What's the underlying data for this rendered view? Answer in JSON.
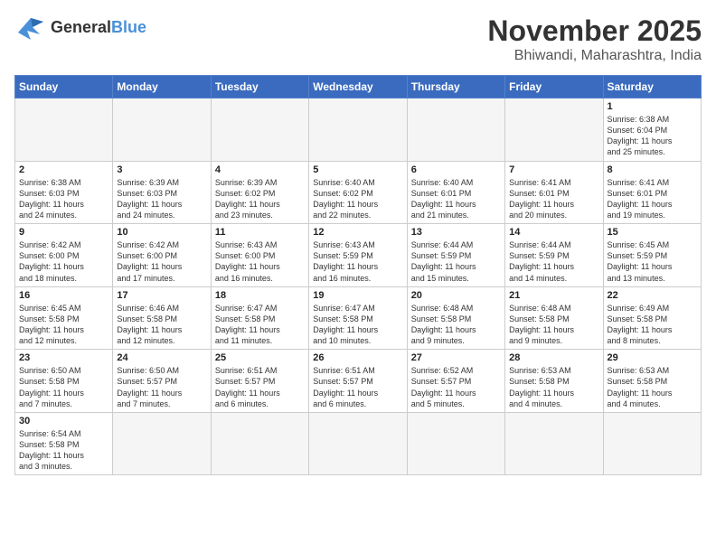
{
  "header": {
    "logo_general": "General",
    "logo_blue": "Blue",
    "month_title": "November 2025",
    "location": "Bhiwandi, Maharashtra, India"
  },
  "days_of_week": [
    "Sunday",
    "Monday",
    "Tuesday",
    "Wednesday",
    "Thursday",
    "Friday",
    "Saturday"
  ],
  "weeks": [
    [
      {
        "day": "",
        "text": ""
      },
      {
        "day": "",
        "text": ""
      },
      {
        "day": "",
        "text": ""
      },
      {
        "day": "",
        "text": ""
      },
      {
        "day": "",
        "text": ""
      },
      {
        "day": "",
        "text": ""
      },
      {
        "day": "1",
        "text": "Sunrise: 6:38 AM\nSunset: 6:04 PM\nDaylight: 11 hours\nand 25 minutes."
      }
    ],
    [
      {
        "day": "2",
        "text": "Sunrise: 6:38 AM\nSunset: 6:03 PM\nDaylight: 11 hours\nand 24 minutes."
      },
      {
        "day": "3",
        "text": "Sunrise: 6:39 AM\nSunset: 6:03 PM\nDaylight: 11 hours\nand 24 minutes."
      },
      {
        "day": "4",
        "text": "Sunrise: 6:39 AM\nSunset: 6:02 PM\nDaylight: 11 hours\nand 23 minutes."
      },
      {
        "day": "5",
        "text": "Sunrise: 6:40 AM\nSunset: 6:02 PM\nDaylight: 11 hours\nand 22 minutes."
      },
      {
        "day": "6",
        "text": "Sunrise: 6:40 AM\nSunset: 6:01 PM\nDaylight: 11 hours\nand 21 minutes."
      },
      {
        "day": "7",
        "text": "Sunrise: 6:41 AM\nSunset: 6:01 PM\nDaylight: 11 hours\nand 20 minutes."
      },
      {
        "day": "8",
        "text": "Sunrise: 6:41 AM\nSunset: 6:01 PM\nDaylight: 11 hours\nand 19 minutes."
      }
    ],
    [
      {
        "day": "9",
        "text": "Sunrise: 6:42 AM\nSunset: 6:00 PM\nDaylight: 11 hours\nand 18 minutes."
      },
      {
        "day": "10",
        "text": "Sunrise: 6:42 AM\nSunset: 6:00 PM\nDaylight: 11 hours\nand 17 minutes."
      },
      {
        "day": "11",
        "text": "Sunrise: 6:43 AM\nSunset: 6:00 PM\nDaylight: 11 hours\nand 16 minutes."
      },
      {
        "day": "12",
        "text": "Sunrise: 6:43 AM\nSunset: 5:59 PM\nDaylight: 11 hours\nand 16 minutes."
      },
      {
        "day": "13",
        "text": "Sunrise: 6:44 AM\nSunset: 5:59 PM\nDaylight: 11 hours\nand 15 minutes."
      },
      {
        "day": "14",
        "text": "Sunrise: 6:44 AM\nSunset: 5:59 PM\nDaylight: 11 hours\nand 14 minutes."
      },
      {
        "day": "15",
        "text": "Sunrise: 6:45 AM\nSunset: 5:59 PM\nDaylight: 11 hours\nand 13 minutes."
      }
    ],
    [
      {
        "day": "16",
        "text": "Sunrise: 6:45 AM\nSunset: 5:58 PM\nDaylight: 11 hours\nand 12 minutes."
      },
      {
        "day": "17",
        "text": "Sunrise: 6:46 AM\nSunset: 5:58 PM\nDaylight: 11 hours\nand 12 minutes."
      },
      {
        "day": "18",
        "text": "Sunrise: 6:47 AM\nSunset: 5:58 PM\nDaylight: 11 hours\nand 11 minutes."
      },
      {
        "day": "19",
        "text": "Sunrise: 6:47 AM\nSunset: 5:58 PM\nDaylight: 11 hours\nand 10 minutes."
      },
      {
        "day": "20",
        "text": "Sunrise: 6:48 AM\nSunset: 5:58 PM\nDaylight: 11 hours\nand 9 minutes."
      },
      {
        "day": "21",
        "text": "Sunrise: 6:48 AM\nSunset: 5:58 PM\nDaylight: 11 hours\nand 9 minutes."
      },
      {
        "day": "22",
        "text": "Sunrise: 6:49 AM\nSunset: 5:58 PM\nDaylight: 11 hours\nand 8 minutes."
      }
    ],
    [
      {
        "day": "23",
        "text": "Sunrise: 6:50 AM\nSunset: 5:58 PM\nDaylight: 11 hours\nand 7 minutes."
      },
      {
        "day": "24",
        "text": "Sunrise: 6:50 AM\nSunset: 5:57 PM\nDaylight: 11 hours\nand 7 minutes."
      },
      {
        "day": "25",
        "text": "Sunrise: 6:51 AM\nSunset: 5:57 PM\nDaylight: 11 hours\nand 6 minutes."
      },
      {
        "day": "26",
        "text": "Sunrise: 6:51 AM\nSunset: 5:57 PM\nDaylight: 11 hours\nand 6 minutes."
      },
      {
        "day": "27",
        "text": "Sunrise: 6:52 AM\nSunset: 5:57 PM\nDaylight: 11 hours\nand 5 minutes."
      },
      {
        "day": "28",
        "text": "Sunrise: 6:53 AM\nSunset: 5:58 PM\nDaylight: 11 hours\nand 4 minutes."
      },
      {
        "day": "29",
        "text": "Sunrise: 6:53 AM\nSunset: 5:58 PM\nDaylight: 11 hours\nand 4 minutes."
      }
    ],
    [
      {
        "day": "30",
        "text": "Sunrise: 6:54 AM\nSunset: 5:58 PM\nDaylight: 11 hours\nand 3 minutes."
      },
      {
        "day": "",
        "text": ""
      },
      {
        "day": "",
        "text": ""
      },
      {
        "day": "",
        "text": ""
      },
      {
        "day": "",
        "text": ""
      },
      {
        "day": "",
        "text": ""
      },
      {
        "day": "",
        "text": ""
      }
    ]
  ]
}
